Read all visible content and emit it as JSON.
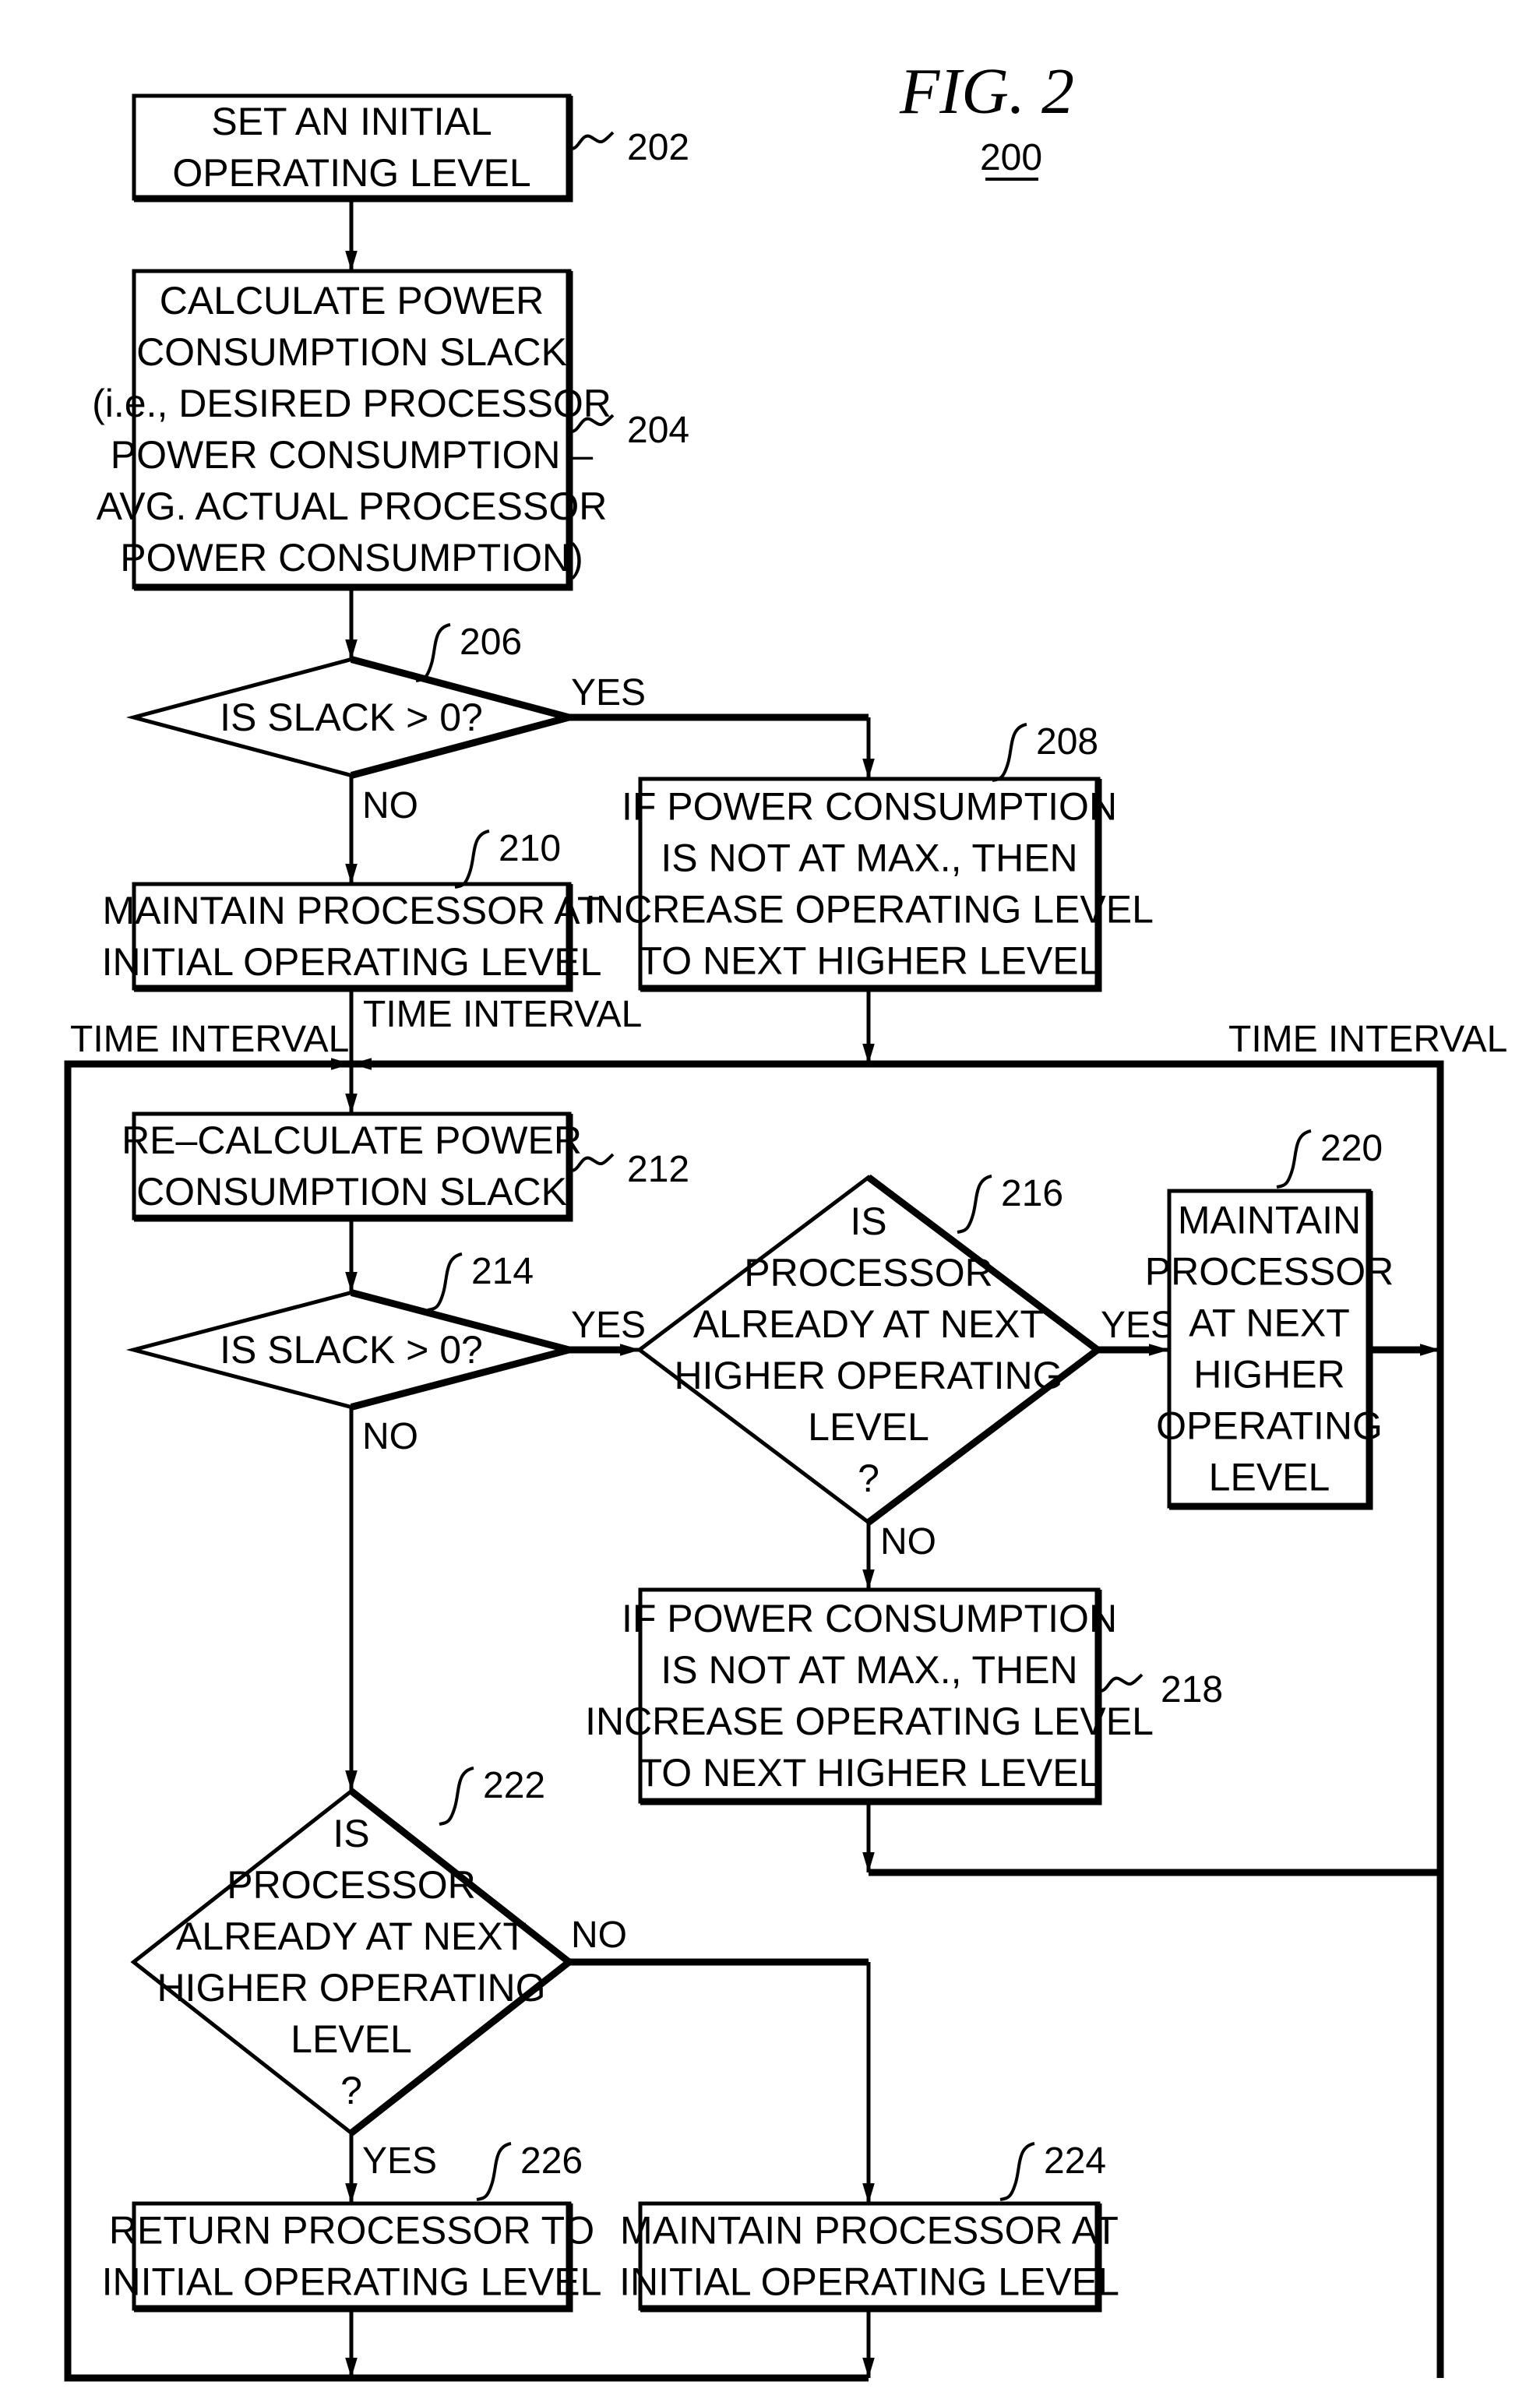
{
  "figure": {
    "title": "FIG.  2",
    "number": "200"
  },
  "nodes": {
    "n202": {
      "ref": "202",
      "type": "process",
      "lines": [
        "SET AN INITIAL",
        "OPERATING LEVEL"
      ]
    },
    "n204": {
      "ref": "204",
      "type": "process",
      "lines": [
        "CALCULATE POWER",
        "CONSUMPTION SLACK",
        "(i.e., DESIRED PROCESSOR",
        "POWER CONSUMPTION –",
        "AVG. ACTUAL PROCESSOR",
        "POWER CONSUMPTION)"
      ]
    },
    "n206": {
      "ref": "206",
      "type": "decision",
      "lines": [
        "IS SLACK > 0?"
      ]
    },
    "n208": {
      "ref": "208",
      "type": "process",
      "lines": [
        "IF POWER CONSUMPTION",
        "IS NOT AT MAX., THEN",
        "INCREASE OPERATING LEVEL",
        "TO NEXT HIGHER LEVEL"
      ]
    },
    "n210": {
      "ref": "210",
      "type": "process",
      "lines": [
        "MAINTAIN PROCESSOR AT",
        "INITIAL OPERATING LEVEL"
      ]
    },
    "n212": {
      "ref": "212",
      "type": "process",
      "lines": [
        "RE–CALCULATE POWER",
        "CONSUMPTION SLACK"
      ]
    },
    "n214": {
      "ref": "214",
      "type": "decision",
      "lines": [
        "IS SLACK > 0?"
      ]
    },
    "n216": {
      "ref": "216",
      "type": "decision",
      "lines": [
        "IS",
        "PROCESSOR",
        "ALREADY AT NEXT",
        "HIGHER OPERATING",
        "LEVEL",
        "?"
      ]
    },
    "n218": {
      "ref": "218",
      "type": "process",
      "lines": [
        "IF POWER CONSUMPTION",
        "IS NOT AT MAX., THEN",
        "INCREASE OPERATING LEVEL",
        "TO NEXT HIGHER LEVEL"
      ]
    },
    "n220": {
      "ref": "220",
      "type": "process",
      "lines": [
        "MAINTAIN",
        "PROCESSOR",
        "AT NEXT",
        "HIGHER",
        "OPERATING",
        "LEVEL"
      ]
    },
    "n222": {
      "ref": "222",
      "type": "decision",
      "lines": [
        "IS",
        "PROCESSOR",
        "ALREADY AT NEXT",
        "HIGHER OPERATING",
        "LEVEL",
        "?"
      ]
    },
    "n224": {
      "ref": "224",
      "type": "process",
      "lines": [
        "MAINTAIN PROCESSOR AT",
        "INITIAL OPERATING LEVEL"
      ]
    },
    "n226": {
      "ref": "226",
      "type": "process",
      "lines": [
        "RETURN PROCESSOR TO",
        "INITIAL OPERATING LEVEL"
      ]
    }
  },
  "edge_labels": {
    "e206_yes": "YES",
    "e206_no": "NO",
    "e214_yes": "YES",
    "e214_no": "NO",
    "e216_yes": "YES",
    "e216_no": "NO",
    "e222_no": "NO",
    "e222_yes": "YES",
    "time_interval_left": "TIME INTERVAL",
    "time_interval_center": "TIME INTERVAL",
    "time_interval_right": "TIME INTERVAL"
  },
  "edges": [
    {
      "from": "202",
      "to": "204"
    },
    {
      "from": "204",
      "to": "206"
    },
    {
      "from": "206",
      "to": "208",
      "label": "YES"
    },
    {
      "from": "206",
      "to": "210",
      "label": "NO"
    },
    {
      "from": "210",
      "to": "212",
      "label": "TIME INTERVAL"
    },
    {
      "from": "208",
      "to": "212"
    },
    {
      "from": "212",
      "to": "214"
    },
    {
      "from": "214",
      "to": "216",
      "label": "YES"
    },
    {
      "from": "214",
      "to": "222",
      "label": "NO"
    },
    {
      "from": "216",
      "to": "220",
      "label": "YES"
    },
    {
      "from": "216",
      "to": "218",
      "label": "NO"
    },
    {
      "from": "220",
      "to": "212",
      "label": "TIME INTERVAL"
    },
    {
      "from": "218",
      "to": "212",
      "label": "TIME INTERVAL"
    },
    {
      "from": "222",
      "to": "224",
      "label": "NO"
    },
    {
      "from": "222",
      "to": "226",
      "label": "YES"
    },
    {
      "from": "224",
      "to": "212",
      "label": "TIME INTERVAL"
    },
    {
      "from": "226",
      "to": "212",
      "label": "TIME INTERVAL"
    }
  ]
}
